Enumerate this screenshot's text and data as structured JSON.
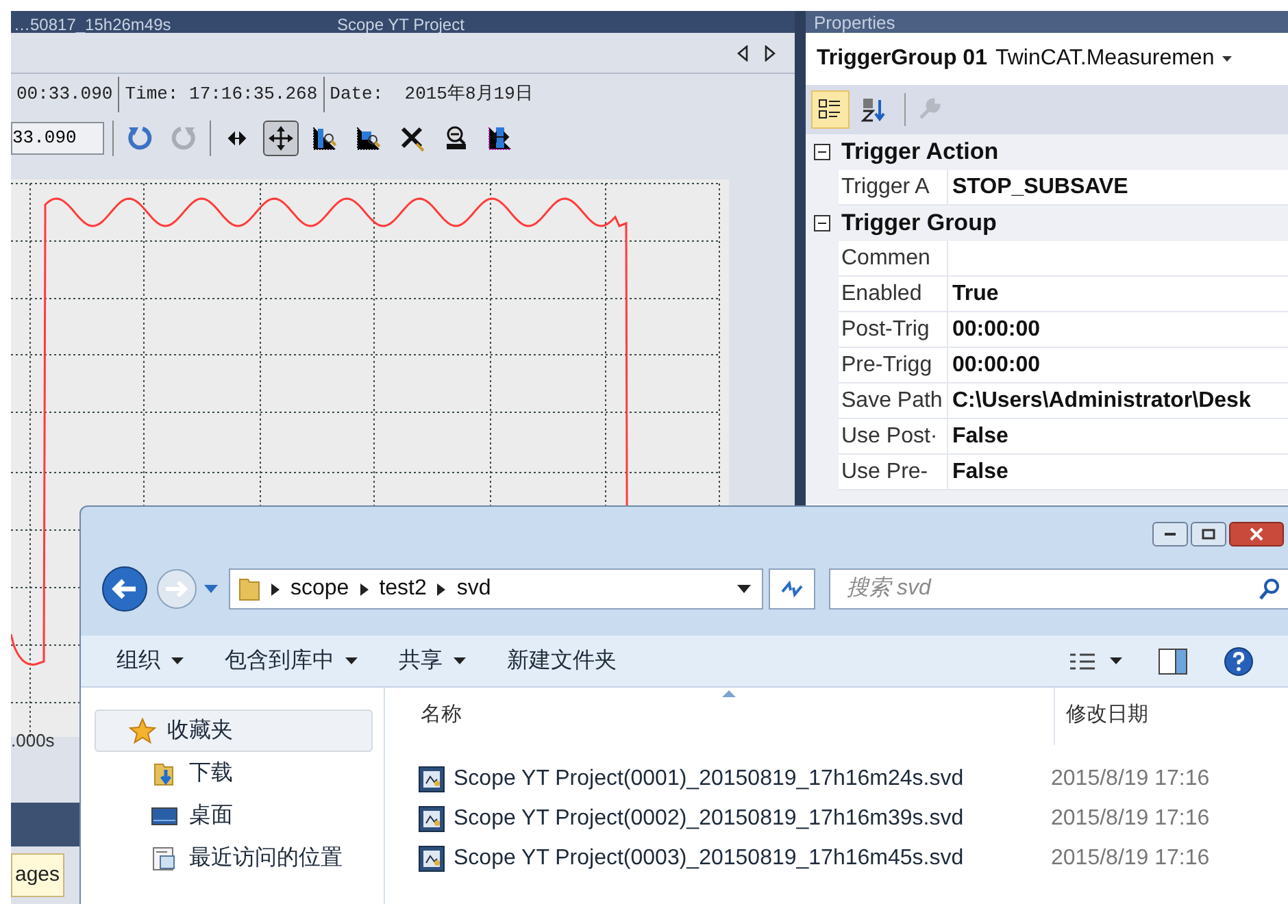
{
  "scope": {
    "doc_tab": "…50817_15h26m49s",
    "title": "Scope YT Project",
    "info": [
      "00:33.090",
      "Time: 17:16:35.268",
      "Date:  2015年8月19日"
    ],
    "field_value": "33.090",
    "tools": [
      {
        "kind": "undo",
        "disabled": false,
        "selected": false
      },
      {
        "kind": "redo",
        "disabled": true,
        "selected": false
      },
      {
        "kind": "pan",
        "disabled": false,
        "selected": false
      },
      {
        "kind": "move",
        "disabled": false,
        "selected": true
      },
      {
        "kind": "zoom-x",
        "disabled": false,
        "selected": false
      },
      {
        "kind": "zoom-box",
        "disabled": false,
        "selected": false
      },
      {
        "kind": "cross",
        "disabled": false,
        "selected": false
      },
      {
        "kind": "zoom-max",
        "disabled": false,
        "selected": false
      },
      {
        "kind": "center",
        "disabled": false,
        "selected": false
      }
    ],
    "axis_label": ".000s",
    "bottom_tab": "ages"
  },
  "properties": {
    "title": "Properties",
    "object_name": "TriggerGroup 01",
    "object_type": "TwinCAT.Measuremen",
    "view_buttons": [
      {
        "kind": "categorized",
        "selected": true
      },
      {
        "kind": "alphabetical",
        "selected": false
      }
    ],
    "categories": [
      {
        "name": "Trigger Action",
        "expanded": true,
        "rows": [
          {
            "label": "Trigger A",
            "value": "STOP_SUBSAVE"
          }
        ]
      },
      {
        "name": "Trigger Group",
        "expanded": true,
        "rows": [
          {
            "label": "Commen"
          },
          {
            "label": "Enabled",
            "value": "True"
          },
          {
            "label": "Post-Trig",
            "value": "00:00:00"
          },
          {
            "label": "Pre-Trigg",
            "value": "00:00:00"
          },
          {
            "label": "Save Path",
            "value": "C:\\Users\\Administrator\\Desk"
          },
          {
            "label": "Use Post·",
            "value": "False"
          },
          {
            "label": "Use Pre-",
            "value": "False"
          }
        ]
      }
    ]
  },
  "explorer": {
    "path": [
      "scope",
      "test2",
      "svd"
    ],
    "search_placeholder": "搜索 svd",
    "commands": [
      {
        "label": "组织",
        "dropdown": true
      },
      {
        "label": "包含到库中",
        "dropdown": true
      },
      {
        "label": "共享",
        "dropdown": true
      },
      {
        "label": "新建文件夹",
        "dropdown": false
      }
    ],
    "nav": [
      {
        "label": "收藏夹",
        "kind": "favorites",
        "selected": true
      },
      {
        "label": "下载",
        "kind": "downloads",
        "selected": false
      },
      {
        "label": "桌面",
        "kind": "desktop",
        "selected": false
      },
      {
        "label": "最近访问的位置",
        "kind": "recent",
        "selected": false
      }
    ],
    "columns": [
      "名称",
      "修改日期"
    ],
    "files": [
      {
        "name": "Scope YT Project(0001)_20150819_17h16m24s.svd",
        "modified": "2015/8/19 17:16"
      },
      {
        "name": "Scope YT Project(0002)_20150819_17h16m39s.svd",
        "modified": "2015/8/19 17:16"
      },
      {
        "name": "Scope YT Project(0003)_20150819_17h16m45s.svd",
        "modified": "2015/8/19 17:16"
      }
    ]
  }
}
